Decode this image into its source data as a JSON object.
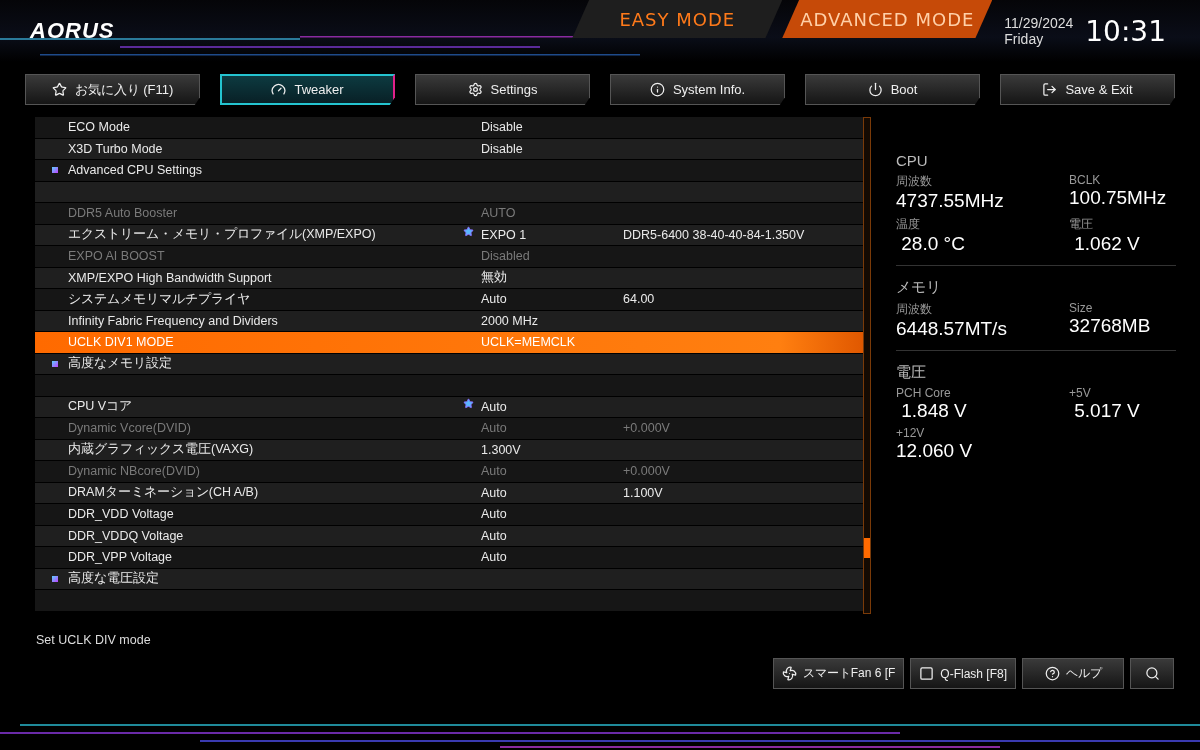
{
  "header": {
    "logo": "AORUS",
    "modes": [
      {
        "label": "EASY MODE",
        "selected": false
      },
      {
        "label": "ADVANCED MODE",
        "selected": true
      }
    ],
    "date": "11/29/2024",
    "day": "Friday",
    "time": "10:31"
  },
  "tabs": [
    {
      "label": "お気に入り (F11)",
      "selected": false
    },
    {
      "label": "Tweaker",
      "selected": true
    },
    {
      "label": "Settings",
      "selected": false
    },
    {
      "label": "System Info.",
      "selected": false
    },
    {
      "label": "Boot",
      "selected": false
    },
    {
      "label": "Save & Exit",
      "selected": false
    }
  ],
  "settings": [
    {
      "kind": "setting",
      "name": "ECO Mode",
      "value": "Disable",
      "disabled": false,
      "selected": false,
      "starred": false
    },
    {
      "kind": "setting",
      "name": "X3D Turbo Mode",
      "value": "Disable",
      "disabled": false,
      "selected": false,
      "starred": false
    },
    {
      "kind": "section",
      "name": "Advanced CPU Settings"
    },
    {
      "kind": "blank"
    },
    {
      "kind": "setting",
      "name": "DDR5 Auto Booster",
      "value": "AUTO",
      "disabled": true,
      "selected": false,
      "starred": false
    },
    {
      "kind": "setting",
      "name": "エクストリーム・メモリ・プロファイル(XMP/EXPO)",
      "value": "EXPO 1",
      "info": "DDR5-6400 38-40-40-84-1.350V",
      "disabled": false,
      "selected": false,
      "starred": true
    },
    {
      "kind": "setting",
      "name": "EXPO AI BOOST",
      "value": "Disabled",
      "disabled": true,
      "selected": false,
      "starred": false
    },
    {
      "kind": "setting",
      "name": "XMP/EXPO High Bandwidth Support",
      "value": "無効",
      "disabled": false,
      "selected": false,
      "starred": false
    },
    {
      "kind": "setting",
      "name": "システムメモリマルチプライヤ",
      "value": "Auto",
      "info": "64.00",
      "disabled": false,
      "selected": false,
      "starred": false
    },
    {
      "kind": "setting",
      "name": "Infinity Fabric Frequency and Dividers",
      "value": "2000 MHz",
      "disabled": false,
      "selected": false,
      "starred": false
    },
    {
      "kind": "setting",
      "name": "UCLK DIV1 MODE",
      "value": "UCLK=MEMCLK",
      "disabled": false,
      "selected": true,
      "starred": false
    },
    {
      "kind": "section",
      "name": "高度なメモリ設定"
    },
    {
      "kind": "blank"
    },
    {
      "kind": "setting",
      "name": "CPU Vコア",
      "value": "Auto",
      "disabled": false,
      "selected": false,
      "starred": true
    },
    {
      "kind": "setting",
      "name": "Dynamic Vcore(DVID)",
      "value": "Auto",
      "info": "+0.000V",
      "disabled": true,
      "selected": false,
      "starred": false
    },
    {
      "kind": "setting",
      "name": "内蔵グラフィックス電圧(VAXG)",
      "value": "1.300V",
      "disabled": false,
      "selected": false,
      "starred": false
    },
    {
      "kind": "setting",
      "name": "Dynamic NBcore(DVID)",
      "value": "Auto",
      "info": "+0.000V",
      "disabled": true,
      "selected": false,
      "starred": false
    },
    {
      "kind": "setting",
      "name": "DRAMターミネーション(CH A/B)",
      "value": "Auto",
      "info": "1.100V",
      "disabled": false,
      "selected": false,
      "starred": false
    },
    {
      "kind": "setting",
      "name": "DDR_VDD Voltage",
      "value": "Auto",
      "disabled": false,
      "selected": false,
      "starred": false
    },
    {
      "kind": "setting",
      "name": "DDR_VDDQ Voltage",
      "value": "Auto",
      "disabled": false,
      "selected": false,
      "starred": false
    },
    {
      "kind": "setting",
      "name": "DDR_VPP Voltage",
      "value": "Auto",
      "disabled": false,
      "selected": false,
      "starred": false
    },
    {
      "kind": "section",
      "name": "高度な電圧設定"
    },
    {
      "kind": "blank"
    }
  ],
  "help_text": "Set UCLK DIV mode",
  "monitor": [
    {
      "title": "CPU",
      "stats": [
        {
          "label": "周波数",
          "value": "4737.55MHz"
        },
        {
          "label": "BCLK",
          "value": "100.75MHz"
        },
        {
          "label": "温度",
          "value": " 28.0 °C"
        },
        {
          "label": "電圧",
          "value": " 1.062 V"
        }
      ]
    },
    {
      "title": "メモリ",
      "stats": [
        {
          "label": "周波数",
          "value": "6448.57MT/s"
        },
        {
          "label": "Size",
          "value": "32768MB"
        }
      ]
    },
    {
      "title": "電圧",
      "stats": [
        {
          "label": "PCH Core",
          "value": " 1.848 V"
        },
        {
          "label": "+5V",
          "value": " 5.017 V"
        },
        {
          "label": "+12V",
          "value": "12.060 V"
        }
      ]
    }
  ],
  "bottom_buttons": [
    "スマートFan 6 [F",
    "Q-Flash [F8]",
    "ヘルプ"
  ]
}
